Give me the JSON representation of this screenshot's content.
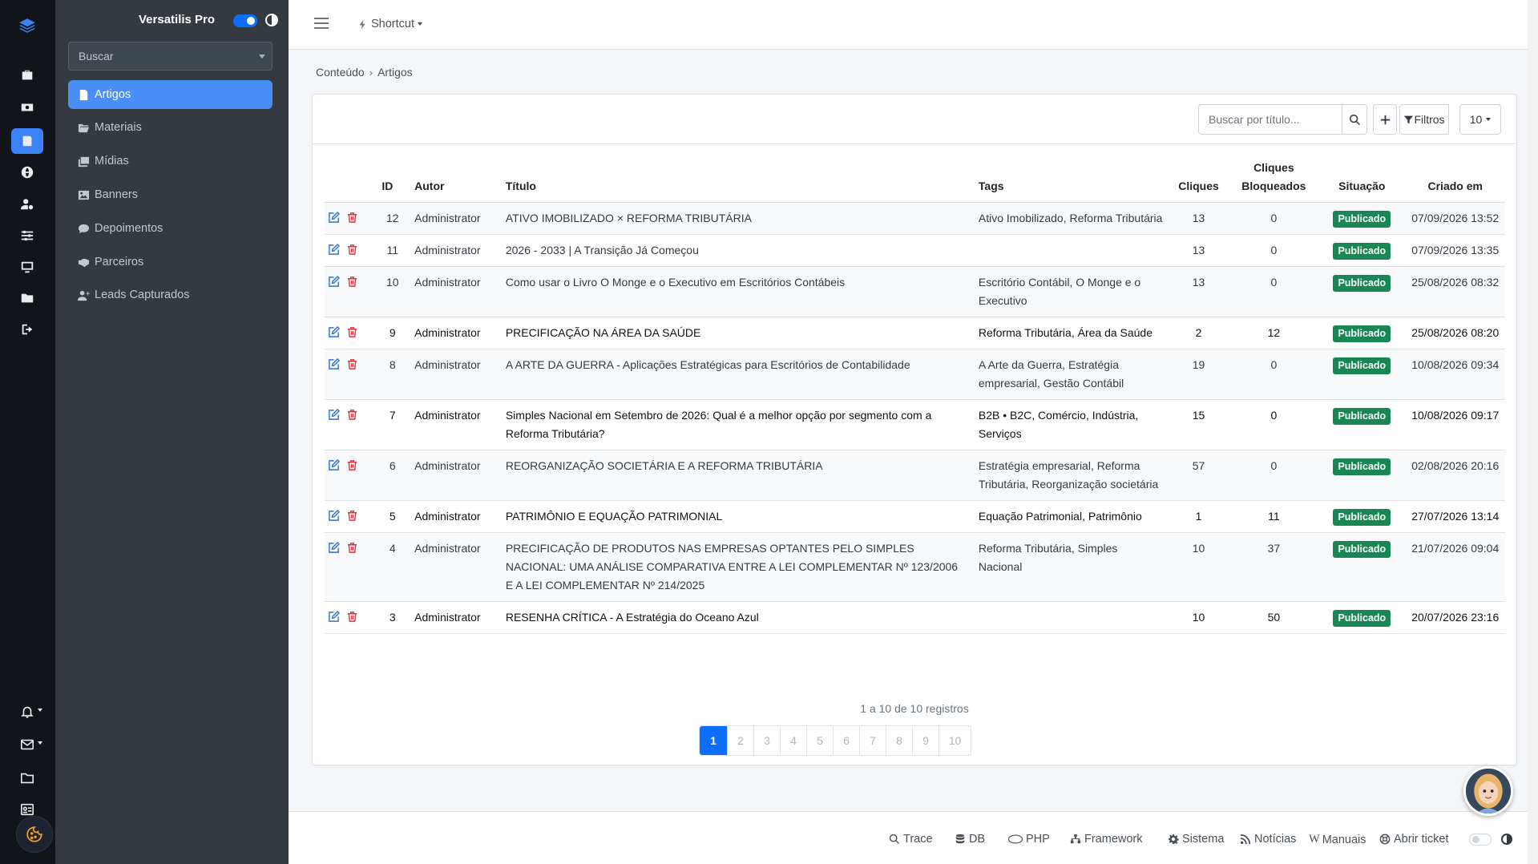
{
  "app": {
    "brand": "Versatilis Pro"
  },
  "sidebar": {
    "search_placeholder": "Buscar",
    "items": [
      {
        "label": "Artigos",
        "icon": "file-icon",
        "active": true
      },
      {
        "label": "Materiais",
        "icon": "folder-open-icon"
      },
      {
        "label": "Mídias",
        "icon": "images-icon"
      },
      {
        "label": "Banners",
        "icon": "image-icon"
      },
      {
        "label": "Depoimentos",
        "icon": "comment-icon"
      },
      {
        "label": "Parceiros",
        "icon": "handshake-icon"
      },
      {
        "label": "Leads Capturados",
        "icon": "user-plus-icon"
      }
    ]
  },
  "topbar": {
    "shortcut_label": "Shortcut"
  },
  "breadcrumb": {
    "parent": "Conteúdo",
    "current": "Artigos"
  },
  "toolbar": {
    "search_placeholder": "Buscar por título...",
    "filters_label": "Filtros",
    "per_page": "10"
  },
  "table": {
    "headers": {
      "id": "ID",
      "author": "Autor",
      "title": "Título",
      "tags": "Tags",
      "clicks": "Cliques",
      "blocked_1": "Cliques",
      "blocked_2": "Bloqueados",
      "status": "Situação",
      "created": "Criado em"
    },
    "rows": [
      {
        "id": "12",
        "author": "Administrator",
        "title": "ATIVO IMOBILIZADO × REFORMA TRIBUTÁRIA",
        "tags": "Ativo Imobilizado, Reforma Tributária",
        "clicks": "13",
        "blocked": "0",
        "status": "Publicado",
        "created": "07/09/2026 13:52"
      },
      {
        "id": "11",
        "author": "Administrator",
        "title": "2026 - 2033 | A Transição Já Começou",
        "tags": "",
        "clicks": "13",
        "blocked": "0",
        "status": "Publicado",
        "created": "07/09/2026 13:35"
      },
      {
        "id": "10",
        "author": "Administrator",
        "title": "Como usar o Livro O Monge e o Executivo em Escritórios Contábeis",
        "tags": "Escritório Contábil, O Monge e o Executivo",
        "clicks": "13",
        "blocked": "0",
        "status": "Publicado",
        "created": "25/08/2026 08:32"
      },
      {
        "id": "9",
        "author": "Administrator",
        "title": "PRECIFICAÇÃO NA ÁREA DA SAÚDE",
        "tags": "Reforma Tributária, Área da Saúde",
        "clicks": "2",
        "blocked": "12",
        "status": "Publicado",
        "created": "25/08/2026 08:20"
      },
      {
        "id": "8",
        "author": "Administrator",
        "title": "A ARTE DA GUERRA - Aplicações Estratégicas para Escritórios de Contabilidade",
        "tags": "A Arte da Guerra, Estratégia empresarial, Gestão Contábil",
        "clicks": "19",
        "blocked": "0",
        "status": "Publicado",
        "created": "10/08/2026 09:34"
      },
      {
        "id": "7",
        "author": "Administrator",
        "title": "Simples Nacional em Setembro de 2026: Qual é a melhor opção por segmento com a Reforma Tributária?",
        "tags": "B2B • B2C, Comércio, Indústria, Serviços",
        "clicks": "15",
        "blocked": "0",
        "status": "Publicado",
        "created": "10/08/2026 09:17"
      },
      {
        "id": "6",
        "author": "Administrator",
        "title": "REORGANIZAÇÃO SOCIETÁRIA E A REFORMA TRIBUTÁRIA",
        "tags": "Estratégia empresarial, Reforma Tributária, Reorganização societária",
        "clicks": "57",
        "blocked": "0",
        "status": "Publicado",
        "created": "02/08/2026 20:16"
      },
      {
        "id": "5",
        "author": "Administrator",
        "title": "PATRIMÔNIO E EQUAÇÃO PATRIMONIAL",
        "tags": "Equação Patrimonial, Patrimônio",
        "clicks": "1",
        "blocked": "11",
        "status": "Publicado",
        "created": "27/07/2026 13:14"
      },
      {
        "id": "4",
        "author": "Administrator",
        "title": "PRECIFICAÇÃO DE PRODUTOS NAS EMPRESAS OPTANTES PELO SIMPLES NACIONAL: UMA ANÁLISE COMPARATIVA ENTRE A LEI COMPLEMENTAR Nº 123/2006 E A LEI COMPLEMENTAR Nº 214/2025",
        "tags": "Reforma Tributária, Simples Nacional",
        "clicks": "10",
        "blocked": "37",
        "status": "Publicado",
        "created": "21/07/2026 09:04"
      },
      {
        "id": "3",
        "author": "Administrator",
        "title": "RESENHA CRÍTICA - A Estratégia do Oceano Azul",
        "tags": "",
        "clicks": "10",
        "blocked": "50",
        "status": "Publicado",
        "created": "20/07/2026 23:16"
      }
    ]
  },
  "pagination": {
    "summary": "1 a 10 de 10 registros",
    "pages": [
      "1",
      "2",
      "3",
      "4",
      "5",
      "6",
      "7",
      "8",
      "9",
      "10"
    ],
    "current": "1"
  },
  "footer": {
    "links": [
      {
        "label": "Trace",
        "icon": "search-icon"
      },
      {
        "label": "DB",
        "icon": "database-icon"
      },
      {
        "label": "PHP",
        "icon": "php-icon"
      },
      {
        "label": "Framework",
        "icon": "sitemap-icon"
      },
      {
        "label": "Sistema",
        "icon": "cog-icon"
      },
      {
        "label": "Notícias",
        "icon": "rss-icon"
      },
      {
        "label": "Manuais",
        "icon": "wikipedia-icon"
      },
      {
        "label": "Abrir ticket",
        "icon": "lifebuoy-icon"
      }
    ]
  },
  "colors": {
    "accent": "#4a8ff7",
    "rail": "#111418",
    "sidebar": "#343a40",
    "published": "#198754",
    "pager_active": "#0d6efd"
  }
}
